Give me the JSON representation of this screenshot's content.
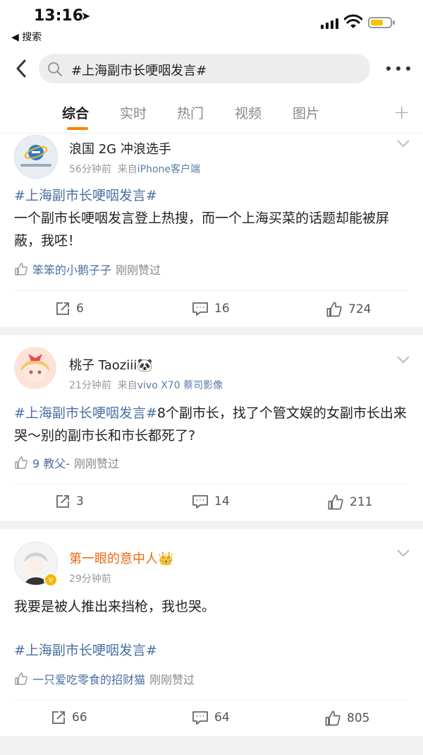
{
  "status_bar": {
    "time": "13:16",
    "back_label": "◀ 搜索"
  },
  "search": {
    "query": "#上海副市长哽咽发言#"
  },
  "tabs": [
    {
      "label": "综合"
    },
    {
      "label": "实时"
    },
    {
      "label": "热门"
    },
    {
      "label": "视频"
    },
    {
      "label": "图片"
    }
  ],
  "accent_color": "#ff8200",
  "posts": [
    {
      "user": "浪国 2G 冲浪选手",
      "time": "56分钟前",
      "source_prefix": "来自",
      "source": "iPhone客户端",
      "hashtag": "#上海副市长哽咽发言#",
      "text": "一个副市长哽咽发言登上热搜，而一个上海买菜的话题却能被屏蔽，我呸！",
      "liker": "笨笨的小鹅子子",
      "liked_suffix": "刚刚赞过",
      "reposts": "6",
      "comments": "16",
      "likes": "724"
    },
    {
      "user": "桃子 Taoziii🐼",
      "time": "21分钟前",
      "source_prefix": "来自",
      "source": "vivo X70 蔡司影像",
      "hashtag": "#上海副市长哽咽发言#",
      "text": "8个副市长，找了个管文娱的女副市长出来哭～别的副市长和市长都死了?",
      "liker": "9 教父-",
      "liked_suffix": "刚刚赞过",
      "reposts": "3",
      "comments": "14",
      "likes": "211"
    },
    {
      "user": "第一眼的意中人👑",
      "time": "29分钟前",
      "text": "我要是被人推出来挡枪，我也哭。",
      "hashtag": "#上海副市长哽咽发言#",
      "liker": "一只爱吃零食的招财猫",
      "liked_suffix": "刚刚赞过",
      "reposts": "66",
      "comments": "64",
      "likes": "805"
    }
  ]
}
